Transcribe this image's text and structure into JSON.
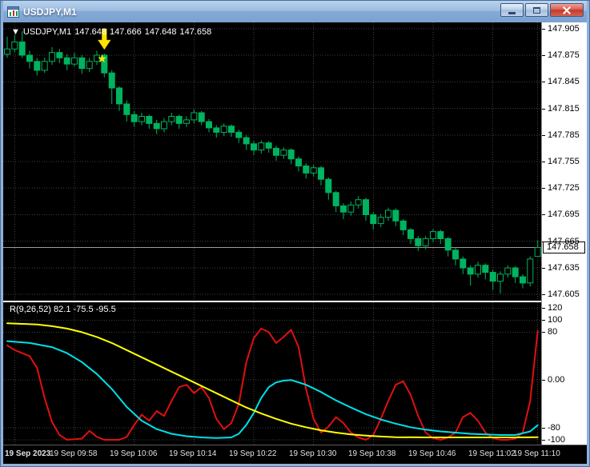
{
  "window": {
    "title": "USDJPY,M1",
    "controls": [
      {
        "name": "minimize"
      },
      {
        "name": "maximize"
      },
      {
        "name": "close"
      }
    ]
  },
  "quote_line": {
    "marker": "▼",
    "symbol": "USDJPY,M1",
    "open": "147.648",
    "high": "147.666",
    "low": "147.648",
    "close": "147.658"
  },
  "indicator_label": "R(9,26,52) 82.1 -75.5 -95.5",
  "price_axis": {
    "labels": [
      "147.905",
      "147.875",
      "147.845",
      "147.815",
      "147.785",
      "147.755",
      "147.725",
      "147.695",
      "147.665",
      "147.635",
      "147.605"
    ],
    "current": "147.658"
  },
  "indicator_axis": {
    "labels": [
      "120",
      "100",
      "80",
      "0.00",
      "-80",
      "-100"
    ],
    "values": [
      120,
      100,
      80,
      0,
      -80,
      -100
    ]
  },
  "time_axis": {
    "labels": [
      "19 Sep 2023",
      "19 Sep 09:58",
      "19 Sep 10:06",
      "19 Sep 10:14",
      "19 Sep 10:22",
      "19 Sep 10:30",
      "19 Sep 10:38",
      "19 Sep 10:46",
      "19 Sep 11:02",
      "19 Sep 11:10"
    ]
  },
  "colors": {
    "candle": "#00b35f",
    "red_line": "#e01010",
    "cyan_line": "#00e0e8",
    "yellow_line": "#ffff00",
    "grid": "#3f3f3f",
    "bid_line": "#9c9c9c",
    "marker": "#ffe400"
  },
  "chart_data": {
    "type": "candlestick",
    "symbol": "USDJPY",
    "timeframe": "M1",
    "title": "USDJPY,M1",
    "price_range": [
      147.598,
      147.912
    ],
    "price_gridlines": [
      147.905,
      147.875,
      147.845,
      147.815,
      147.785,
      147.755,
      147.725,
      147.695,
      147.665,
      147.635,
      147.605
    ],
    "grid_bars": [
      1,
      9,
      17,
      25,
      33,
      41,
      49,
      57,
      65,
      71
    ],
    "bid": 147.658,
    "marker": {
      "bar": 13,
      "arrow_icon": "down-arrow",
      "star_icon": "star",
      "star_glyph": "★"
    },
    "candles": [
      [
        147.876,
        147.896,
        147.872,
        147.882
      ],
      [
        147.882,
        147.898,
        147.878,
        147.89
      ],
      [
        147.89,
        147.902,
        147.872,
        147.875
      ],
      [
        147.875,
        147.88,
        147.86,
        147.868
      ],
      [
        147.868,
        147.872,
        147.852,
        147.858
      ],
      [
        147.858,
        147.872,
        147.855,
        147.868
      ],
      [
        147.868,
        147.884,
        147.864,
        147.878
      ],
      [
        147.878,
        147.882,
        147.866,
        147.872
      ],
      [
        147.872,
        147.876,
        147.858,
        147.865
      ],
      [
        147.865,
        147.878,
        147.862,
        147.872
      ],
      [
        147.872,
        147.875,
        147.854,
        147.86
      ],
      [
        147.86,
        147.872,
        147.856,
        147.868
      ],
      [
        147.868,
        147.88,
        147.864,
        147.875
      ],
      [
        147.875,
        147.877,
        147.85,
        147.855
      ],
      [
        147.855,
        147.858,
        147.82,
        147.838
      ],
      [
        147.838,
        147.84,
        147.812,
        147.82
      ],
      [
        147.82,
        147.824,
        147.8,
        147.808
      ],
      [
        147.808,
        147.812,
        147.794,
        147.8
      ],
      [
        147.8,
        147.81,
        147.796,
        147.806
      ],
      [
        147.806,
        147.808,
        147.792,
        147.798
      ],
      [
        147.798,
        147.802,
        147.786,
        147.792
      ],
      [
        147.792,
        147.804,
        147.788,
        147.8
      ],
      [
        147.8,
        147.81,
        147.796,
        147.806
      ],
      [
        147.806,
        147.808,
        147.792,
        147.798
      ],
      [
        147.798,
        147.806,
        147.794,
        147.802
      ],
      [
        147.802,
        147.814,
        147.798,
        147.81
      ],
      [
        147.81,
        147.812,
        147.796,
        147.8
      ],
      [
        147.8,
        147.803,
        147.788,
        147.793
      ],
      [
        147.793,
        147.796,
        147.782,
        147.788
      ],
      [
        147.788,
        147.798,
        147.784,
        147.795
      ],
      [
        147.795,
        147.797,
        147.783,
        147.788
      ],
      [
        147.788,
        147.791,
        147.776,
        147.782
      ],
      [
        147.782,
        147.785,
        147.768,
        147.775
      ],
      [
        147.775,
        147.778,
        147.762,
        147.768
      ],
      [
        147.768,
        147.779,
        147.764,
        147.776
      ],
      [
        147.776,
        147.778,
        147.765,
        147.77
      ],
      [
        147.77,
        147.773,
        147.756,
        147.762
      ],
      [
        147.762,
        147.771,
        147.758,
        147.768
      ],
      [
        147.768,
        147.77,
        147.752,
        147.758
      ],
      [
        147.758,
        147.761,
        147.744,
        147.75
      ],
      [
        147.75,
        147.753,
        147.736,
        147.742
      ],
      [
        147.742,
        147.751,
        147.738,
        147.748
      ],
      [
        147.748,
        147.75,
        147.728,
        147.735
      ],
      [
        147.735,
        147.737,
        147.712,
        147.72
      ],
      [
        147.72,
        147.722,
        147.698,
        147.705
      ],
      [
        147.705,
        147.708,
        147.69,
        147.698
      ],
      [
        147.698,
        147.71,
        147.694,
        147.706
      ],
      [
        147.706,
        147.716,
        147.702,
        147.712
      ],
      [
        147.712,
        147.714,
        147.688,
        147.695
      ],
      [
        147.695,
        147.698,
        147.678,
        147.685
      ],
      [
        147.685,
        147.696,
        147.681,
        147.692
      ],
      [
        147.692,
        147.703,
        147.688,
        147.7
      ],
      [
        147.7,
        147.702,
        147.682,
        147.688
      ],
      [
        147.688,
        147.69,
        147.672,
        147.678
      ],
      [
        147.678,
        147.68,
        147.662,
        147.668
      ],
      [
        147.668,
        147.671,
        147.654,
        147.66
      ],
      [
        147.66,
        147.671,
        147.656,
        147.668
      ],
      [
        147.668,
        147.679,
        147.664,
        147.676
      ],
      [
        147.676,
        147.678,
        147.662,
        147.668
      ],
      [
        147.668,
        147.67,
        147.648,
        147.655
      ],
      [
        147.655,
        147.658,
        147.638,
        147.645
      ],
      [
        147.645,
        147.648,
        147.628,
        147.635
      ],
      [
        147.635,
        147.638,
        147.615,
        147.628
      ],
      [
        147.628,
        147.642,
        147.624,
        147.638
      ],
      [
        147.638,
        147.64,
        147.622,
        147.63
      ],
      [
        147.63,
        147.633,
        147.61,
        147.62
      ],
      [
        147.62,
        147.631,
        147.606,
        147.628
      ],
      [
        147.628,
        147.638,
        147.624,
        147.635
      ],
      [
        147.635,
        147.637,
        147.618,
        147.625
      ],
      [
        147.625,
        147.628,
        147.612,
        147.618
      ],
      [
        147.618,
        147.648,
        147.614,
        147.645
      ],
      [
        147.648,
        147.666,
        147.648,
        147.658
      ]
    ],
    "indicator": {
      "name": "R(9,26,52)",
      "values": [
        82.1,
        -75.5,
        -95.5
      ],
      "range": [
        -108,
        130
      ],
      "levels": [
        120,
        100,
        80,
        0,
        -80,
        -100
      ],
      "series": [
        {
          "name": "r9",
          "color_key": "red_line",
          "points": [
            [
              0,
              58
            ],
            [
              1,
              50
            ],
            [
              2,
              45
            ],
            [
              3,
              40
            ],
            [
              4,
              20
            ],
            [
              5,
              -30
            ],
            [
              6,
              -70
            ],
            [
              7,
              -92
            ],
            [
              8,
              -100
            ],
            [
              10,
              -98
            ],
            [
              11,
              -85
            ],
            [
              12,
              -95
            ],
            [
              13,
              -100
            ],
            [
              15,
              -100
            ],
            [
              16,
              -95
            ],
            [
              17,
              -75
            ],
            [
              18,
              -58
            ],
            [
              19,
              -68
            ],
            [
              20,
              -52
            ],
            [
              21,
              -60
            ],
            [
              22,
              -35
            ],
            [
              23,
              -12
            ],
            [
              24,
              -8
            ],
            [
              25,
              -22
            ],
            [
              26,
              -12
            ],
            [
              27,
              -30
            ],
            [
              28,
              -65
            ],
            [
              29,
              -82
            ],
            [
              30,
              -72
            ],
            [
              31,
              -40
            ],
            [
              32,
              30
            ],
            [
              33,
              70
            ],
            [
              34,
              86
            ],
            [
              35,
              80
            ],
            [
              36,
              62
            ],
            [
              37,
              72
            ],
            [
              38,
              84
            ],
            [
              39,
              55
            ],
            [
              40,
              -15
            ],
            [
              41,
              -65
            ],
            [
              42,
              -88
            ],
            [
              43,
              -78
            ],
            [
              44,
              -62
            ],
            [
              45,
              -72
            ],
            [
              46,
              -88
            ],
            [
              47,
              -96
            ],
            [
              48,
              -100
            ],
            [
              49,
              -92
            ],
            [
              50,
              -65
            ],
            [
              51,
              -35
            ],
            [
              52,
              -8
            ],
            [
              53,
              -2
            ],
            [
              54,
              -25
            ],
            [
              55,
              -60
            ],
            [
              56,
              -88
            ],
            [
              57,
              -97
            ],
            [
              58,
              -100
            ],
            [
              59,
              -96
            ],
            [
              60,
              -88
            ],
            [
              61,
              -62
            ],
            [
              62,
              -55
            ],
            [
              63,
              -68
            ],
            [
              64,
              -88
            ],
            [
              65,
              -97
            ],
            [
              66,
              -100
            ],
            [
              67,
              -100
            ],
            [
              68,
              -98
            ],
            [
              69,
              -88
            ],
            [
              70,
              -35
            ],
            [
              71,
              82.1
            ]
          ]
        },
        {
          "name": "r26",
          "color_key": "cyan_line",
          "points": [
            [
              0,
              65
            ],
            [
              3,
              62
            ],
            [
              6,
              55
            ],
            [
              8,
              45
            ],
            [
              10,
              30
            ],
            [
              12,
              10
            ],
            [
              14,
              -15
            ],
            [
              16,
              -45
            ],
            [
              18,
              -68
            ],
            [
              20,
              -82
            ],
            [
              22,
              -90
            ],
            [
              24,
              -94
            ],
            [
              26,
              -96
            ],
            [
              28,
              -97
            ],
            [
              30,
              -96
            ],
            [
              31,
              -90
            ],
            [
              32,
              -75
            ],
            [
              33,
              -55
            ],
            [
              34,
              -30
            ],
            [
              35,
              -12
            ],
            [
              36,
              -4
            ],
            [
              37,
              -1
            ],
            [
              38,
              0
            ],
            [
              40,
              -8
            ],
            [
              42,
              -20
            ],
            [
              44,
              -34
            ],
            [
              46,
              -46
            ],
            [
              48,
              -57
            ],
            [
              50,
              -66
            ],
            [
              52,
              -73
            ],
            [
              54,
              -79
            ],
            [
              56,
              -83
            ],
            [
              58,
              -86
            ],
            [
              60,
              -88
            ],
            [
              62,
              -90
            ],
            [
              64,
              -91
            ],
            [
              66,
              -92
            ],
            [
              68,
              -92
            ],
            [
              70,
              -86
            ],
            [
              71,
              -75.5
            ]
          ]
        },
        {
          "name": "r52",
          "color_key": "yellow_line",
          "points": [
            [
              0,
              95
            ],
            [
              4,
              93
            ],
            [
              6,
              90
            ],
            [
              8,
              86
            ],
            [
              10,
              80
            ],
            [
              12,
              72
            ],
            [
              14,
              62
            ],
            [
              16,
              50
            ],
            [
              18,
              38
            ],
            [
              20,
              26
            ],
            [
              22,
              14
            ],
            [
              24,
              2
            ],
            [
              26,
              -10
            ],
            [
              28,
              -22
            ],
            [
              30,
              -34
            ],
            [
              32,
              -46
            ],
            [
              34,
              -56
            ],
            [
              36,
              -65
            ],
            [
              38,
              -73
            ],
            [
              40,
              -79
            ],
            [
              42,
              -84
            ],
            [
              44,
              -88
            ],
            [
              46,
              -91
            ],
            [
              48,
              -93
            ],
            [
              50,
              -94.5
            ],
            [
              52,
              -95.5
            ],
            [
              56,
              -96
            ],
            [
              60,
              -96
            ],
            [
              64,
              -96
            ],
            [
              68,
              -96
            ],
            [
              71,
              -95.5
            ]
          ]
        }
      ]
    }
  }
}
